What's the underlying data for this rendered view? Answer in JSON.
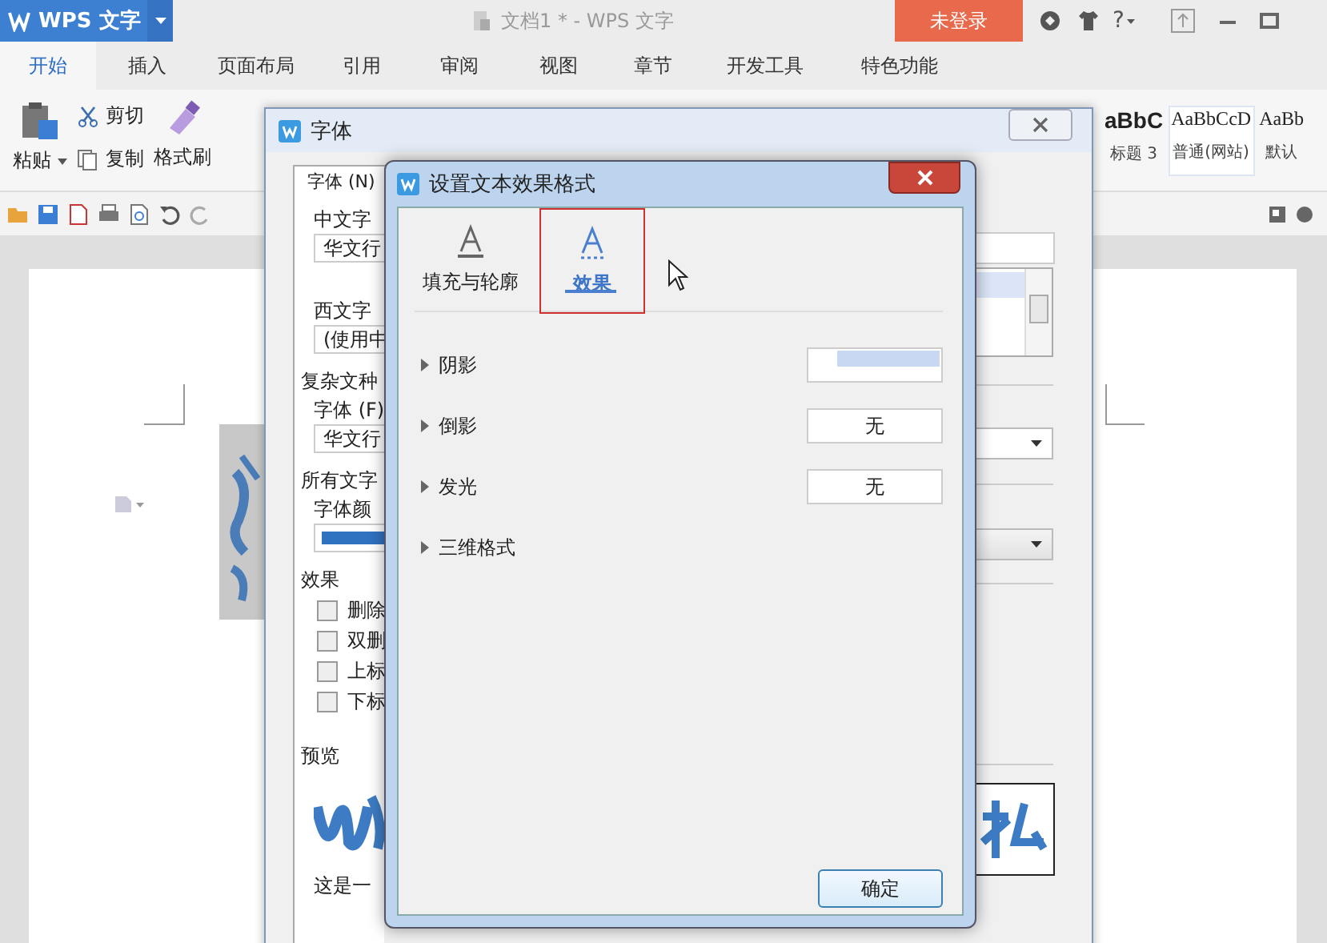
{
  "app": {
    "logo": "WPS 文字",
    "doc_title": "文档1 * - WPS 文字",
    "login": "未登录",
    "help": "?"
  },
  "ribbon_tabs": [
    {
      "label": "开始",
      "selected": true
    },
    {
      "label": "插入",
      "selected": false
    },
    {
      "label": "页面布局",
      "selected": false
    },
    {
      "label": "引用",
      "selected": false
    },
    {
      "label": "审阅",
      "selected": false
    },
    {
      "label": "视图",
      "selected": false
    },
    {
      "label": "章节",
      "selected": false
    },
    {
      "label": "开发工具",
      "selected": false
    },
    {
      "label": "特色功能",
      "selected": false
    }
  ],
  "clipboard": {
    "paste": "粘贴",
    "cut": "剪切",
    "copy": "复制",
    "painter": "格式刷"
  },
  "styles": [
    {
      "sample": "aBbC",
      "name": "标题 3",
      "selected": false
    },
    {
      "sample": "AaBbCcD",
      "name": "普通(网站)",
      "selected": true
    },
    {
      "sample": "AaBb",
      "name": "默认",
      "selected": false
    }
  ],
  "font_dialog": {
    "title": "字体",
    "tab": "字体 (N)",
    "chinese_font_label": "中文字",
    "chinese_font": "华文行",
    "western_font_label": "西文字",
    "western_font": "(使用中",
    "complex_label": "复杂文种",
    "complex_font_label": "字体 (F)",
    "complex_font": "华文行",
    "all_text_label": "所有文字",
    "color_label": "字体颜",
    "effects_label": "效果",
    "effects": [
      {
        "label": "删除",
        "checked": false
      },
      {
        "label": "双删",
        "checked": false
      },
      {
        "label": "上标",
        "checked": false
      },
      {
        "label": "下标",
        "checked": false
      }
    ],
    "preview_label": "预览",
    "preview_caption": "这是一"
  },
  "effects_dialog": {
    "title": "设置文本效果格式",
    "tabs": [
      {
        "label": "填充与轮廓",
        "selected": false
      },
      {
        "label": "效果",
        "selected": true
      }
    ],
    "sections": [
      {
        "label": "阴影",
        "kind": "preset",
        "highlighted": true
      },
      {
        "label": "倒影",
        "kind": "preset",
        "value": "无",
        "highlighted": false
      },
      {
        "label": "发光",
        "kind": "preset",
        "value": "无",
        "highlighted": false
      },
      {
        "label": "三维格式",
        "kind": "group"
      }
    ],
    "ok": "确定"
  }
}
